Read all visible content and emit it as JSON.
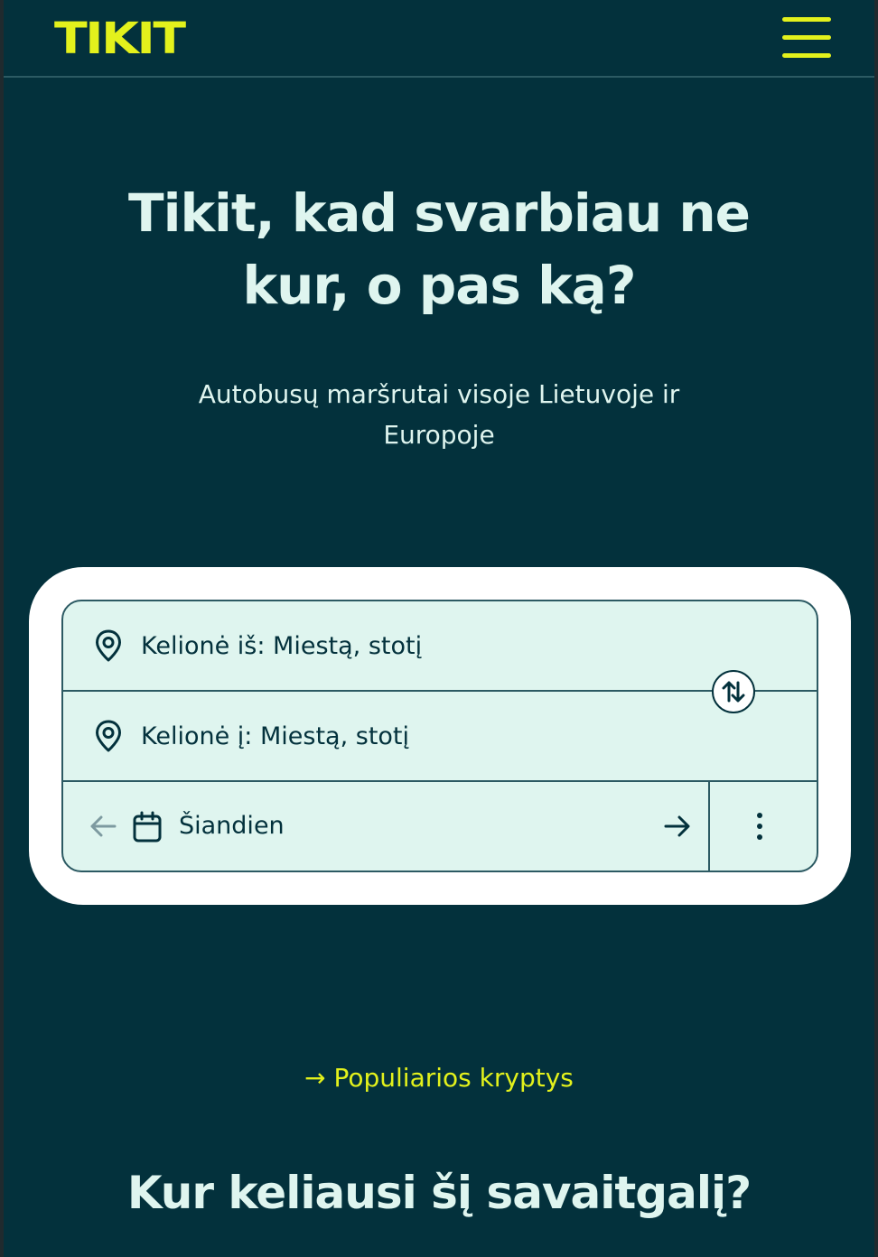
{
  "header": {
    "logo_text": "TIKIT",
    "menu_icon": "hamburger-menu-icon"
  },
  "hero": {
    "title": "Tikit, kad svarbiau ne kur, o pas ką?",
    "subtitle": "Autobusų maršrutai visoje Lietuvoje ir Europoje"
  },
  "search": {
    "from_label": "Kelionė iš: Miestą, stotį",
    "to_label": "Kelionė į: Miestą, stotį",
    "date_label": "Šiandien",
    "icons": {
      "from": "map-pin-icon",
      "to": "map-pin-icon",
      "swap": "swap-arrows-icon",
      "prev_day": "arrow-left-icon",
      "calendar": "calendar-icon",
      "next_day": "arrow-right-icon",
      "more": "more-vertical-icon"
    }
  },
  "links": {
    "popular": "→ Populiarios kryptys"
  },
  "sections": {
    "weekend_title": "Kur keliausi šį savaitgalį?"
  },
  "colors": {
    "background": "#03313c",
    "accent": "#e3f11c",
    "text_light": "#dff5ef",
    "input_bg": "#dff5ef",
    "border": "#2c5a63"
  }
}
